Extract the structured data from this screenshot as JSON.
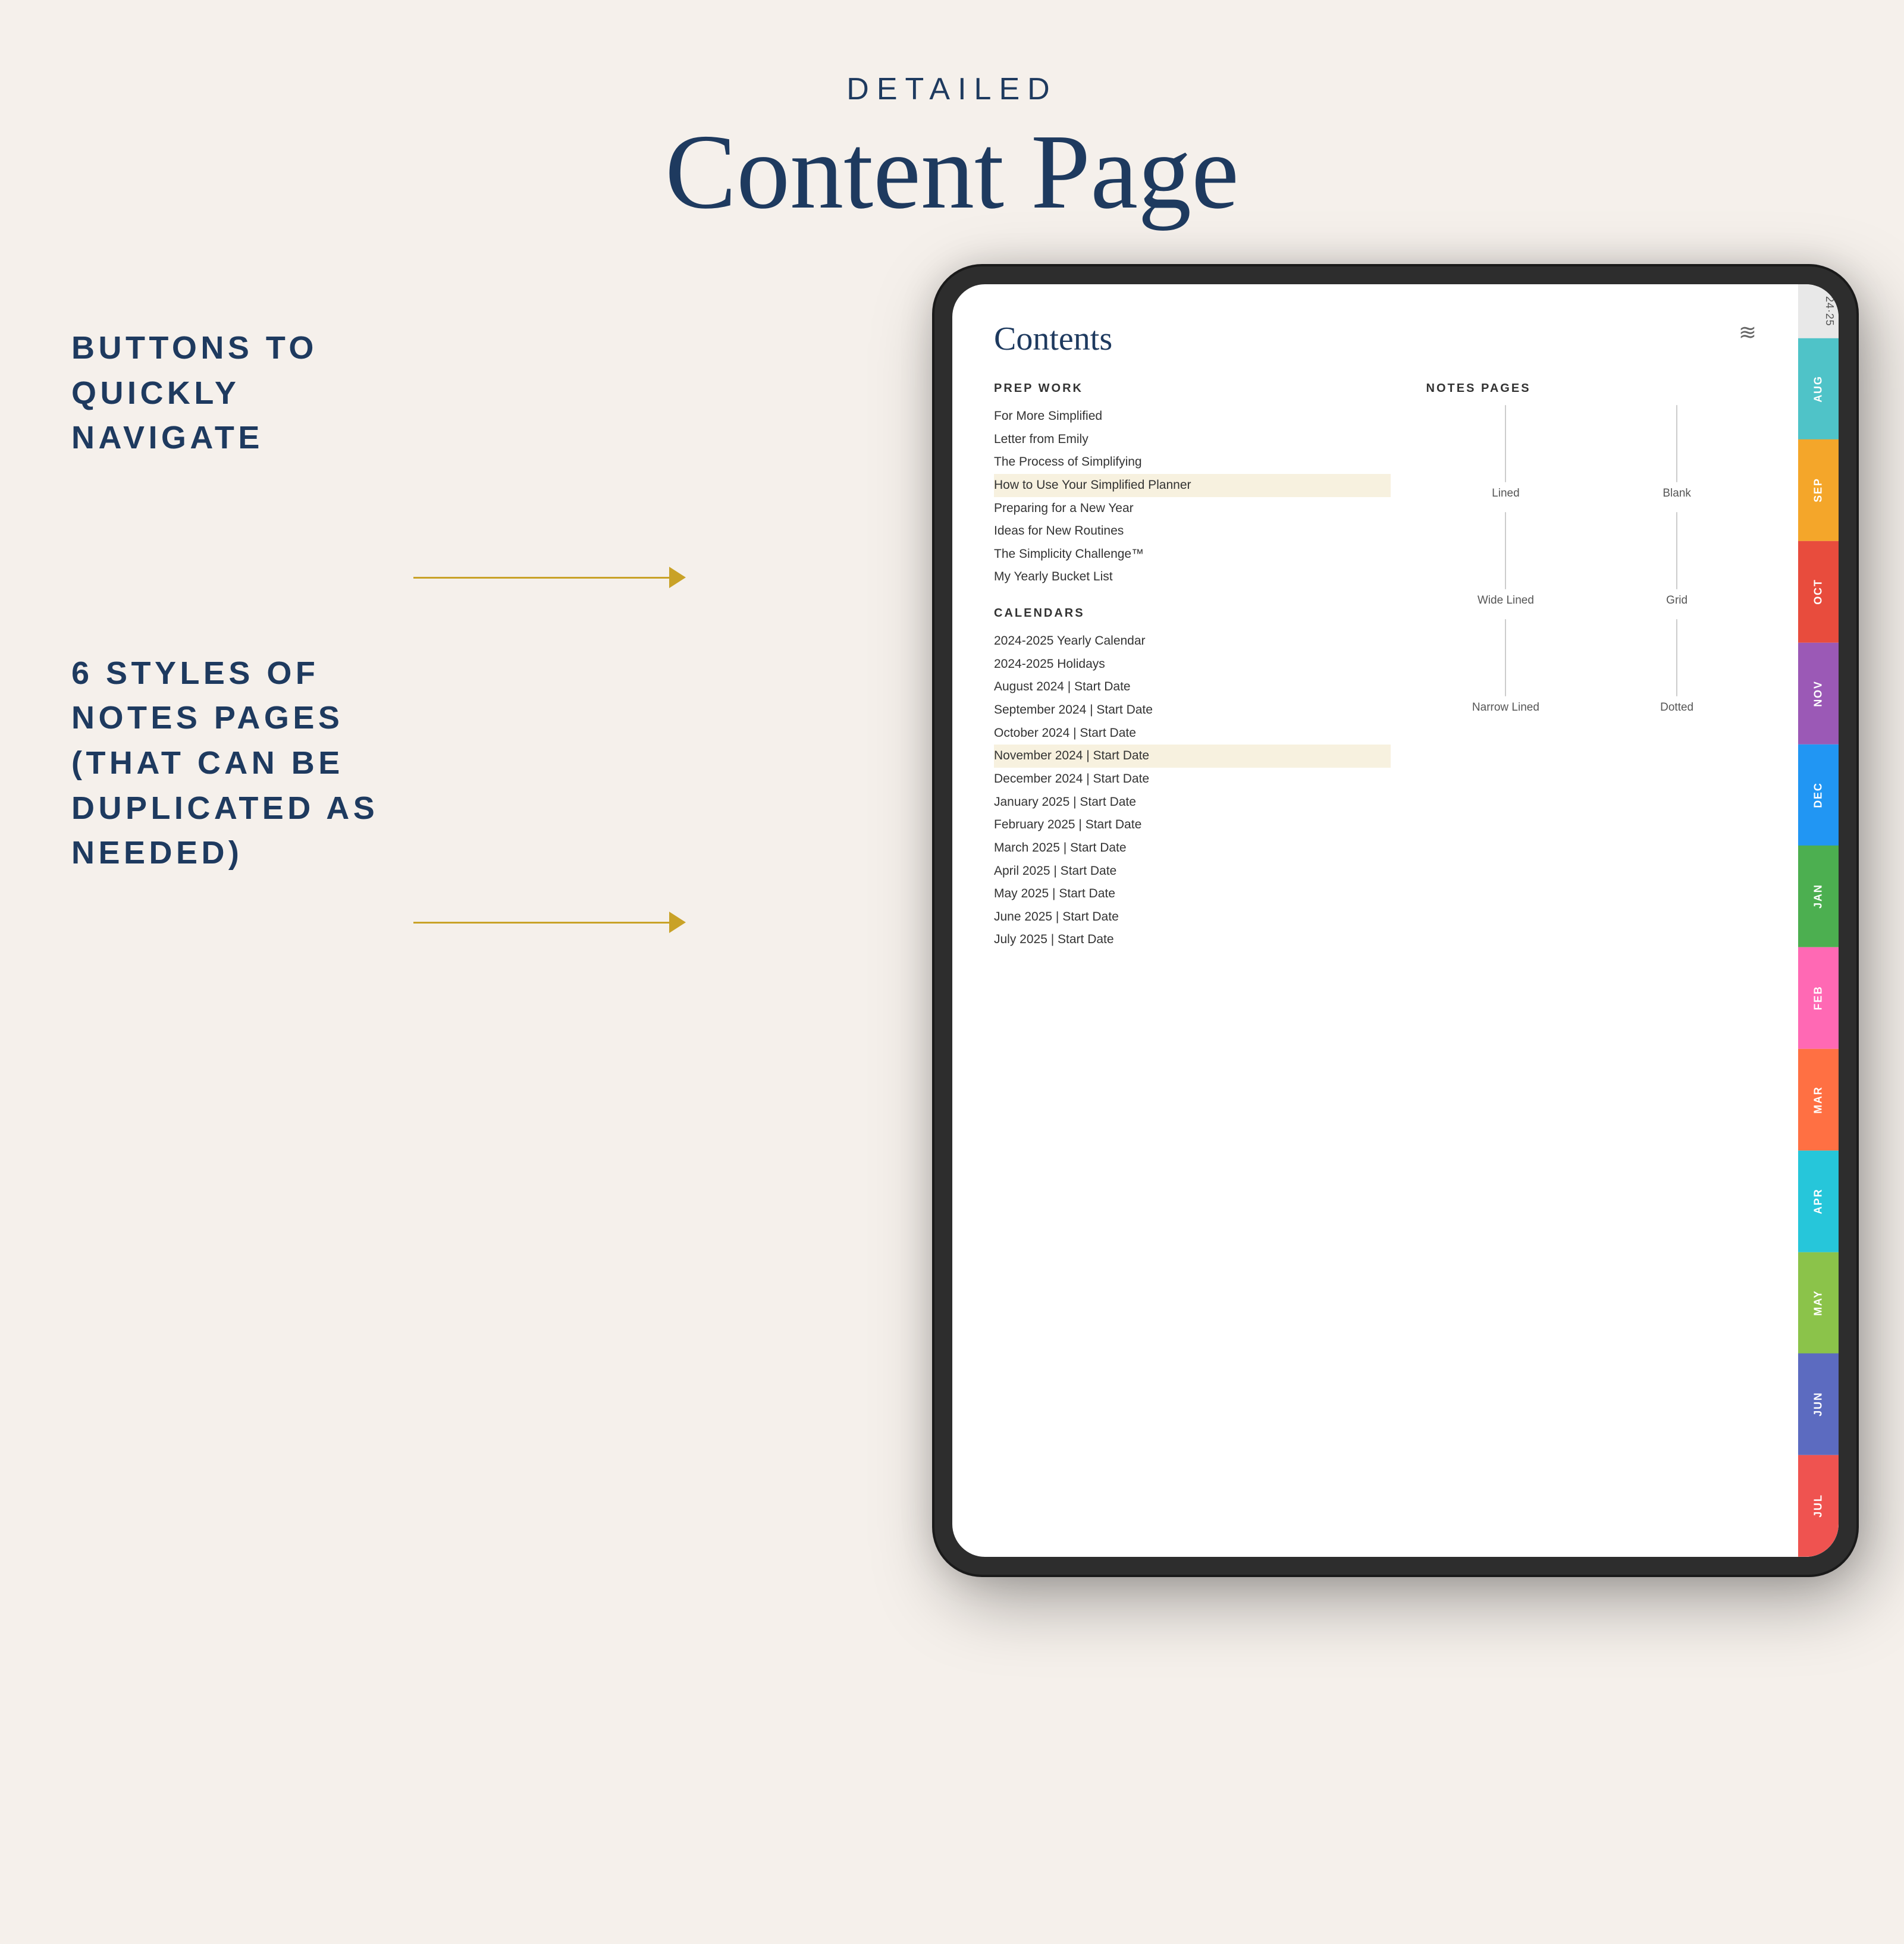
{
  "header": {
    "subtitle": "DETAILED",
    "title": "Content Page"
  },
  "left_annotations": [
    {
      "id": "annotation-navigate",
      "text": "BUTTONS TO\nQUICKLY\nNAVIGATE"
    },
    {
      "id": "annotation-notes",
      "text": "6 STYLES OF\nNOTES PAGES\n(THAT CAN BE\nDUPLICATED AS\nNEEDED)"
    }
  ],
  "tablet": {
    "contents_title": "Contents",
    "menu_icon": "≋",
    "prep_work_heading": "PREP WORK",
    "prep_work_items": [
      "For More Simplified",
      "Letter from Emily",
      "The Process of Simplifying",
      "How to Use Your Simplified Planner",
      "Preparing for a New Year",
      "Ideas for New Routines",
      "The Simplicity Challenge™",
      "My Yearly Bucket List"
    ],
    "calendars_heading": "CALENDARS",
    "calendar_items": [
      "2024-2025 Yearly Calendar",
      "2024-2025 Holidays",
      "August 2024  |  Start Date",
      "September 2024  |  Start Date",
      "October 2024  |  Start Date",
      "November 2024  |  Start Date",
      "December 2024  |  Start Date",
      "January 2025  |  Start Date",
      "February 2025  |  Start Date",
      "March 2025  |  Start Date",
      "April 2025  |  Start Date",
      "May 2025  |  Start Date",
      "June 2025  |  Start Date",
      "July 2025  |  Start Date"
    ],
    "notes_heading": "NOTES PAGES",
    "notes_types": [
      {
        "id": "lined",
        "label": "Lined"
      },
      {
        "id": "blank",
        "label": "Blank"
      },
      {
        "id": "wide-lined",
        "label": "Wide Lined"
      },
      {
        "id": "grid",
        "label": "Grid"
      },
      {
        "id": "narrow-lined",
        "label": "Narrow Lined"
      },
      {
        "id": "dotted",
        "label": "Dotted"
      }
    ],
    "tabs": [
      {
        "id": "year",
        "label": "24·25",
        "class": "tab-year"
      },
      {
        "id": "aug",
        "label": "AUG",
        "class": "tab-aug"
      },
      {
        "id": "sep",
        "label": "SEP",
        "class": "tab-sep"
      },
      {
        "id": "oct",
        "label": "OCT",
        "class": "tab-oct"
      },
      {
        "id": "nov",
        "label": "NOV",
        "class": "tab-nov"
      },
      {
        "id": "dec",
        "label": "DEC",
        "class": "tab-dec"
      },
      {
        "id": "jan",
        "label": "JAN",
        "class": "tab-jan"
      },
      {
        "id": "feb",
        "label": "FEB",
        "class": "tab-feb"
      },
      {
        "id": "mar",
        "label": "MAR",
        "class": "tab-mar"
      },
      {
        "id": "apr",
        "label": "APR",
        "class": "tab-apr"
      },
      {
        "id": "may",
        "label": "MAY",
        "class": "tab-may"
      },
      {
        "id": "jun",
        "label": "JUN",
        "class": "tab-jun"
      },
      {
        "id": "jul",
        "label": "JUL",
        "class": "tab-jul"
      }
    ]
  }
}
